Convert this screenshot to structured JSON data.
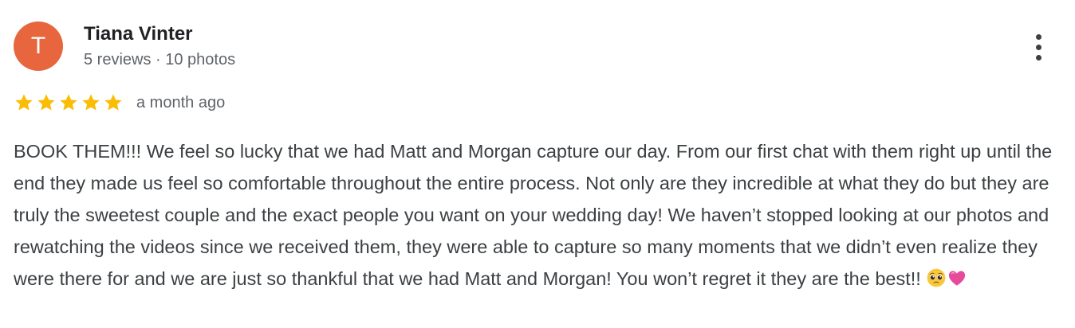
{
  "reviewer": {
    "avatar_letter": "T",
    "avatar_color": "#e8663d",
    "name": "Tiana Vinter",
    "stats": "5 reviews · 10 photos"
  },
  "review": {
    "rating": 5,
    "rating_max": 5,
    "star_color": "#fbbc04",
    "date": "a month ago",
    "text": "BOOK THEM!!! We feel so lucky that we had Matt and Morgan capture our day. From our first chat with them right up until the end they made us feel so comfortable throughout the entire process. Not only are they incredible at what they do but they are truly the sweetest couple and the exact people you want on your wedding day! We haven’t stopped looking at our photos and rewatching the videos since we received them, they were able to capture so many moments that we didn’t even realize they were there for and we are just so thankful that we had Matt and Morgan! You won’t regret it they are the best!!",
    "emojis": [
      "pleading-face-emoji",
      "pink-heart-emoji"
    ]
  },
  "menu": {
    "icon": "more-vert-icon"
  }
}
